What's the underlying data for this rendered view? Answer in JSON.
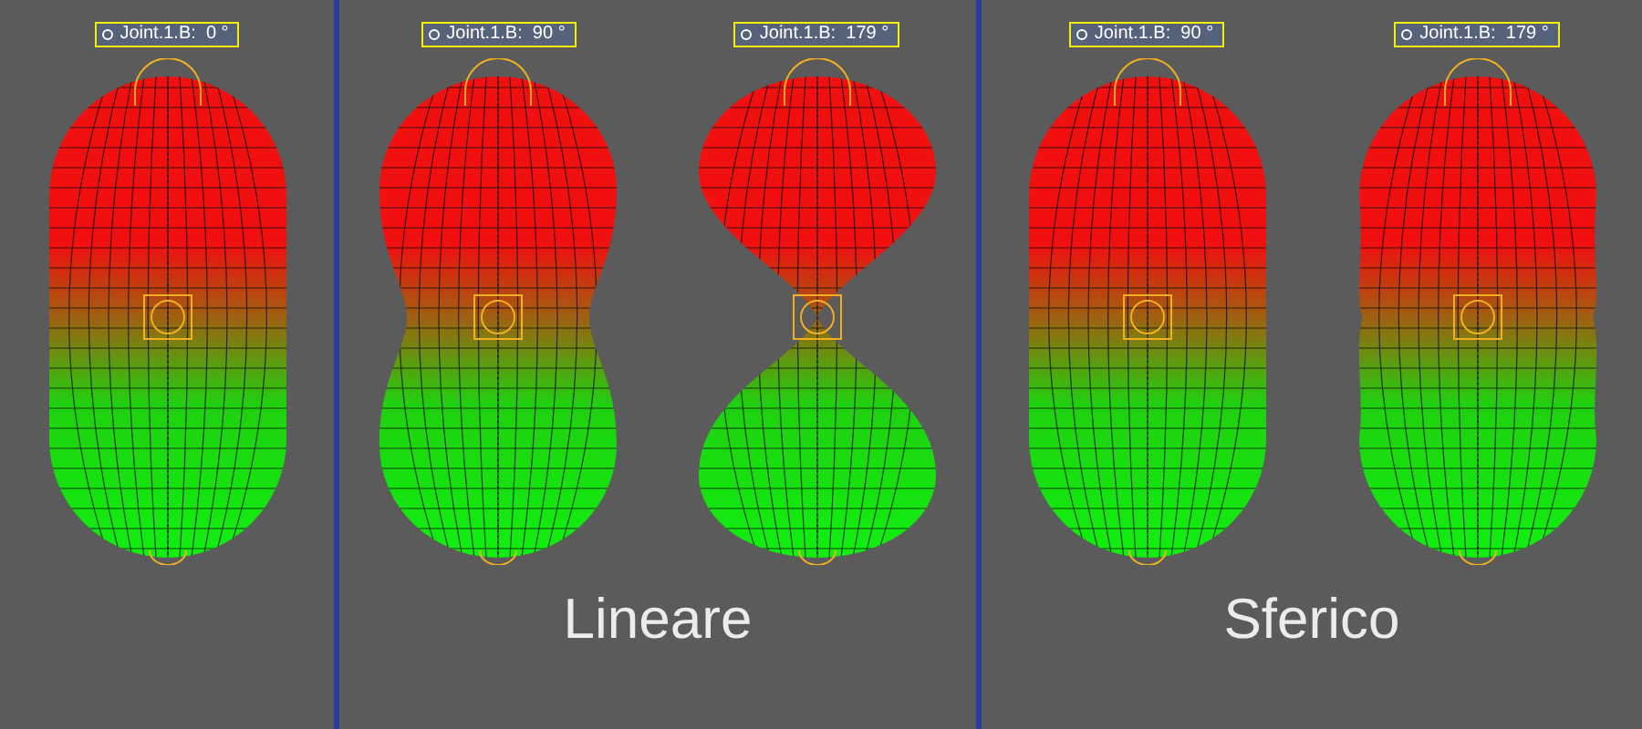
{
  "panels": [
    {
      "figures": [
        {
          "label": "Joint.1.B:  0 °",
          "kind": "capsule"
        }
      ]
    },
    {
      "caption": "Lineare",
      "figures": [
        {
          "label": "Joint.1.B:  90 °",
          "kind": "waist"
        },
        {
          "label": "Joint.1.B:  179 °",
          "kind": "pinch"
        }
      ]
    },
    {
      "caption": "Sferico",
      "figures": [
        {
          "label": "Joint.1.B:  90 °",
          "kind": "capsule"
        },
        {
          "label": "Joint.1.B:  179 °",
          "kind": "ripple"
        }
      ]
    }
  ]
}
